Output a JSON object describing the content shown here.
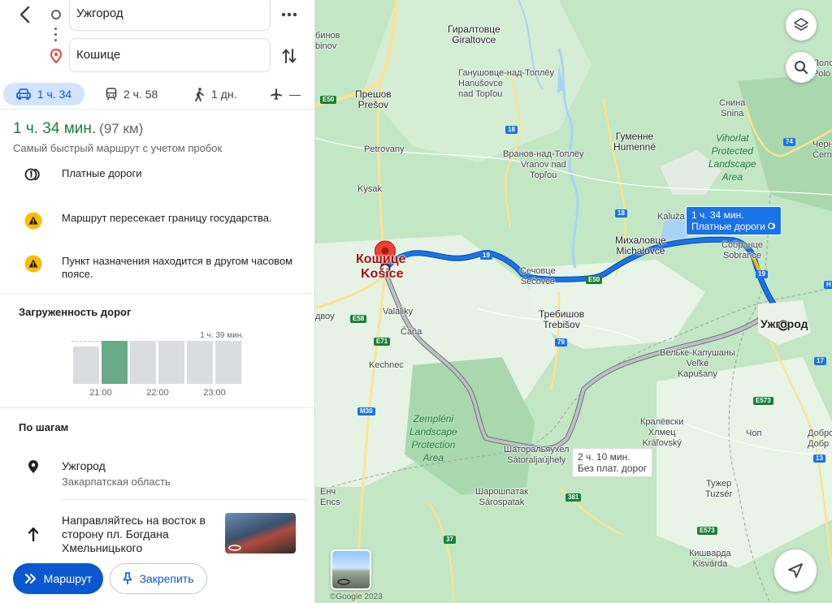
{
  "directions": {
    "from": "Ужгород",
    "to": "Кошице",
    "modes": [
      {
        "name": "car",
        "label": "1 ч. 34"
      },
      {
        "name": "transit",
        "label": "2 ч. 58"
      },
      {
        "name": "walk",
        "label": "1 дн."
      },
      {
        "name": "flight",
        "label": "—"
      }
    ],
    "selected_mode": "car"
  },
  "summary": {
    "duration": "1 ч. 34 мин.",
    "distance": "(97 км)",
    "note": "Самый быстрый маршрут с учетом пробок"
  },
  "notices": [
    {
      "icon": "toll-icon",
      "text": "Платные дороги"
    },
    {
      "icon": "warning-icon",
      "text": "Маршрут пересекает границу государства."
    },
    {
      "icon": "warning-icon",
      "text": "Пункт назначения находится в другом часовом поясе."
    }
  ],
  "traffic": {
    "title": "Загруженность дорог",
    "max_label": "1 ч. 39 мин.",
    "ticks": [
      "21:00",
      "22:00",
      "23:00"
    ],
    "bars": [
      0.7,
      0.8,
      0.8,
      0.8,
      0.8,
      0.8
    ],
    "active_index": 1
  },
  "steps": {
    "title": "По шагам",
    "items": [
      {
        "icon": "place-icon",
        "title": "Ужгород",
        "subtitle": "Закарпатская область"
      },
      {
        "icon": "arrow-up-icon",
        "title": "Направляйтесь на восток в сторону пл. Богдана Хмельницького",
        "subtitle": ""
      }
    ]
  },
  "buttons": {
    "route": "Маршрут",
    "pin": "Закрепить"
  },
  "map": {
    "route_main": {
      "line1": "1 ч. 34 мин.",
      "line2": "Платные дороги"
    },
    "route_alt": {
      "line1": "2 ч. 10 мин.",
      "line2": "Без плат. дорог"
    },
    "cities": {
      "kosice_ru": "Кошице",
      "kosice_sk": "Košice",
      "uzhhorod": "Ужгород"
    },
    "labels": {
      "girul": "Гиралтовце\nGiraltovce",
      "ganus": "Ганушовце-над-Топлёу\nHanušovce\nnad Topľou",
      "presov": "Прешов\nPrešov",
      "binov": "бинов\nbinov",
      "petrovany": "Petrovany",
      "kysak": "Kysak",
      "gumenne": "Гуменне\nHumenné",
      "vranov": "Вранов-над-Топлёу\nVranov nad\nTopľou",
      "snina": "Снина\nSnina",
      "kaluza": "Kaluža",
      "mihal": "Михаловце\nMichalovce",
      "sobr": "Собранце\nSobrance",
      "secovce": "Сечовце\nSečovce",
      "trebisov": "Требишов\nTrebišov",
      "valaliky": "Valaliky",
      "cana": "Čaňa",
      "kechnec": "Kechnec",
      "dvou": "двоу",
      "velke": "Вельке-Капушаны\nVeľké\nKapušany",
      "kralov": "Кралёвски\nХлмец\nKráľovský",
      "satoral": "Шаторальяухел\nSátoraljaújhely",
      "sarospatak": "Шарошпатак\nSárospatak",
      "ench": "Енч\nEncs",
      "chop": "Чоп",
      "tuzser": "Тужер\nTuzsér",
      "kisvarda": "Кишварда\nKisvárda",
      "dobr": "Доброн\nДобр",
      "cerna": "Черн\nČern",
      "polo": "Полон\nPolo"
    },
    "parks": {
      "vihorlat": "Vihorlat\nProtected\nLandscape\nArea",
      "zempleni": "Zempléni\nLandscape\nProtection\nArea"
    },
    "shields": {
      "e50a": "E50",
      "e50b": "E50",
      "r18a": "18",
      "r18b": "18",
      "r19a": "19",
      "r19b": "19",
      "r74": "74",
      "r79": "79",
      "e58": "E58",
      "e71": "E71",
      "m30": "M30",
      "r37": "37",
      "r381": "381",
      "e573a": "E573",
      "e573b": "E573",
      "r17": "17",
      "r13": "13",
      "h": "H"
    },
    "copyright": "©Google 2023"
  },
  "colors": {
    "accent": "#0b57d0",
    "route_main": "#1a73e8",
    "route_alt": "#9aa0a6",
    "success": "#188038",
    "warning": "#fbbc04",
    "dest_pin": "#ea4335"
  }
}
